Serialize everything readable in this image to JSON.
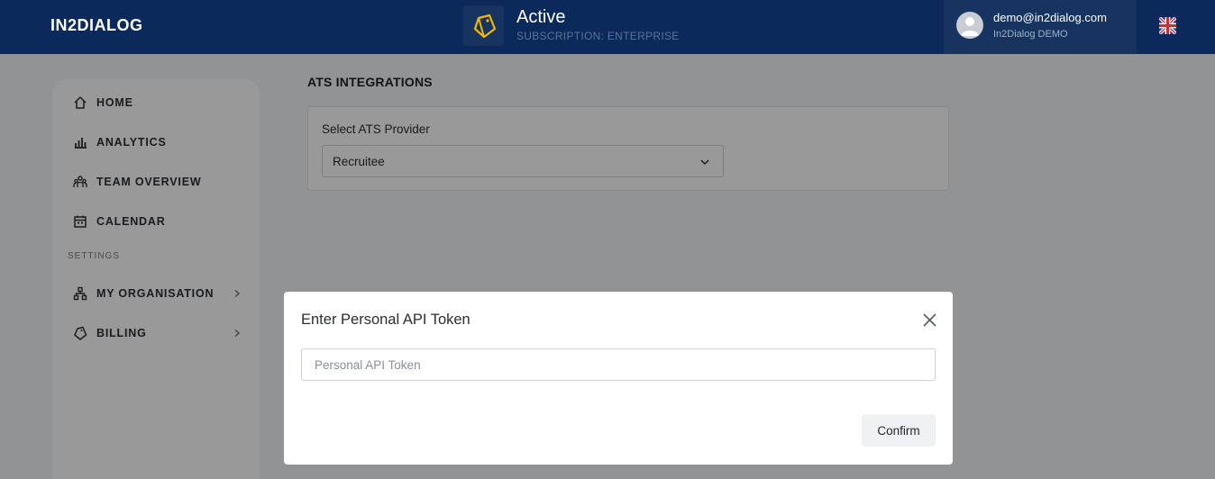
{
  "header": {
    "logo_text": "IN2DIALOG",
    "subscription_status": "Active",
    "subscription_plan": "SUBSCRIPTION: ENTERPRISE",
    "user_email": "demo@in2dialog.com",
    "user_org": "In2Dialog DEMO",
    "language_flag": "uk-flag-icon"
  },
  "sidebar": {
    "items": [
      {
        "label": "HOME",
        "icon": "home-icon"
      },
      {
        "label": "ANALYTICS",
        "icon": "analytics-icon"
      },
      {
        "label": "TEAM OVERVIEW",
        "icon": "team-icon"
      },
      {
        "label": "CALENDAR",
        "icon": "calendar-icon"
      }
    ],
    "settings_heading": "SETTINGS",
    "settings_items": [
      {
        "label": "MY ORGANISATION",
        "icon": "organisation-icon"
      },
      {
        "label": "BILLING",
        "icon": "billing-icon"
      }
    ]
  },
  "main": {
    "title": "ATS INTEGRATIONS",
    "provider_label": "Select ATS Provider",
    "provider_value": "Recruitee"
  },
  "modal": {
    "title": "Enter Personal API Token",
    "input_placeholder": "Personal API Token",
    "input_value": "",
    "confirm_label": "Confirm"
  },
  "colors": {
    "topbar": "#0b2a5b",
    "user_area": "#16345f",
    "subscription_icon": "#f2b705"
  }
}
